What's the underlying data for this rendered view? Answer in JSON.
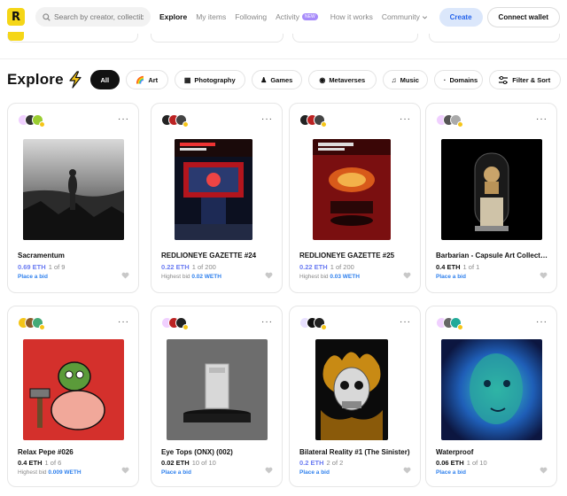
{
  "header": {
    "logo_letter": "R",
    "search_placeholder": "Search by creator, collectib",
    "nav": [
      {
        "label": "Explore",
        "active": true
      },
      {
        "label": "My items"
      },
      {
        "label": "Following"
      },
      {
        "label": "Activity",
        "badge": "NEW"
      },
      {
        "label": "How it works"
      },
      {
        "label": "Community"
      }
    ],
    "create_label": "Create",
    "wallet_label": "Connect wallet"
  },
  "explore": {
    "title": "Explore",
    "filters": [
      {
        "label": "All",
        "active": true,
        "icon": ""
      },
      {
        "label": "Art",
        "icon": "🌈"
      },
      {
        "label": "Photography",
        "icon": "▦"
      },
      {
        "label": "Games",
        "icon": "♟"
      },
      {
        "label": "Metaverses",
        "icon": "◉"
      },
      {
        "label": "Music",
        "icon": "♫"
      },
      {
        "label": "Domains",
        "icon": "·"
      }
    ],
    "filter_sort_label": "Filter & Sort"
  },
  "cards": [
    {
      "name": "Sacramentum",
      "price": "0.69 ETH",
      "edition": "1 of 9",
      "bid_label": "",
      "bid": "Place a bid",
      "price_blue": true,
      "avatar_colors": [
        "#f0d0ff",
        "#333",
        "#9acd32"
      ]
    },
    {
      "name": "REDLIONEYE GAZETTE #24",
      "price": "0.22 ETH",
      "edition": "1 of 200",
      "bid_label": "Highest bid",
      "bid": "0.02 WETH",
      "price_blue": true,
      "avatar_colors": [
        "#222",
        "#b22",
        "#444"
      ]
    },
    {
      "name": "REDLIONEYE GAZETTE #25",
      "price": "0.22 ETH",
      "edition": "1 of 200",
      "bid_label": "Highest bid",
      "bid": "0.03 WETH",
      "price_blue": true,
      "avatar_colors": [
        "#222",
        "#b22",
        "#444"
      ]
    },
    {
      "name": "Barbarian - Capsule Art Collection",
      "price": "0.4 ETH",
      "edition": "1 of 1",
      "bid_label": "",
      "bid": "Place a bid",
      "price_blue": false,
      "avatar_colors": [
        "#f0d0ff",
        "#555",
        "#aaa"
      ]
    },
    {
      "name": "Relax Pepe #026",
      "price": "0.4 ETH",
      "edition": "1 of 6",
      "bid_label": "Highest bid",
      "bid": "0.009 WETH",
      "price_blue": false,
      "avatar_colors": [
        "#f5c518",
        "#8b5a2b",
        "#4a7"
      ]
    },
    {
      "name": "Eye Tops (ONX) (002)",
      "price": "0.02 ETH",
      "edition": "10 of 10",
      "bid_label": "",
      "bid": "Place a bid",
      "price_blue": false,
      "avatar_colors": [
        "#f0d0ff",
        "#b22",
        "#222"
      ]
    },
    {
      "name": "Bilateral Reality #1 (The Sinister)",
      "price": "0.2 ETH",
      "edition": "2 of 2",
      "bid_label": "",
      "bid": "Place a bid",
      "price_blue": true,
      "avatar_colors": [
        "#e8e0ff",
        "#111",
        "#222"
      ]
    },
    {
      "name": "Waterproof",
      "price": "0.06 ETH",
      "edition": "1 of 10",
      "bid_label": "",
      "bid": "Place a bid",
      "price_blue": false,
      "avatar_colors": [
        "#f0d0ff",
        "#666",
        "#2a9"
      ]
    }
  ]
}
